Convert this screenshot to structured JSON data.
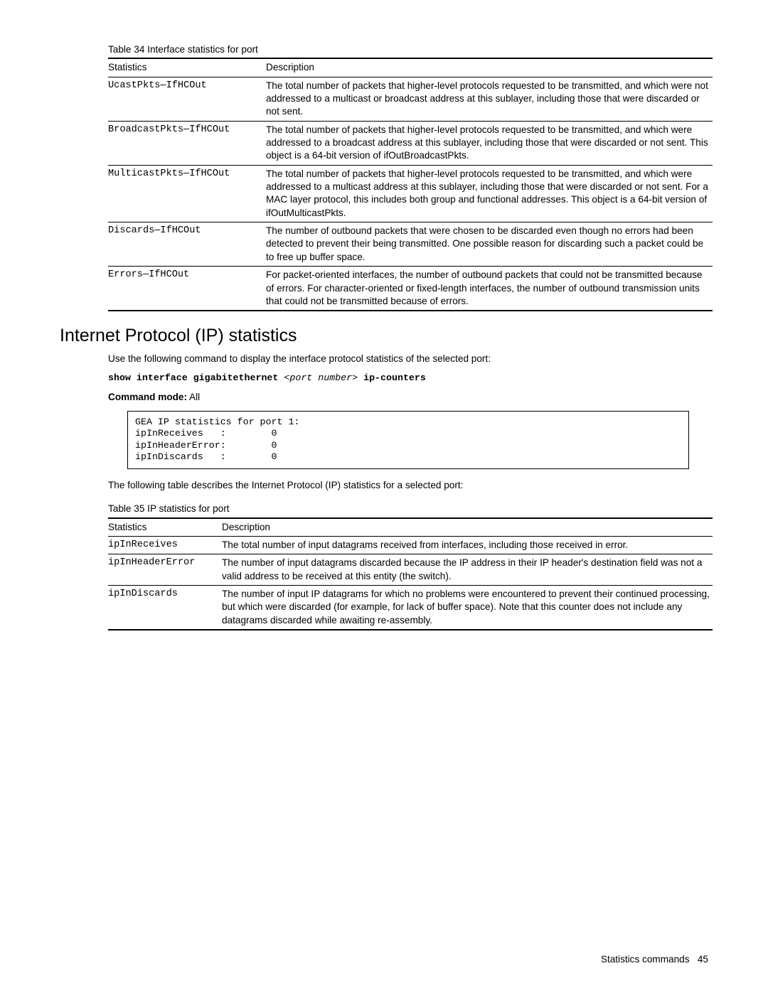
{
  "table34": {
    "caption": "Table 34  Interface statistics for port",
    "head": {
      "c1": "Statistics",
      "c2": "Description"
    },
    "rows": [
      {
        "stat": "UcastPkts—IfHCOut",
        "desc": "The total number of packets that higher-level protocols requested to be transmitted, and which were not addressed to a multicast or broadcast address at this sublayer, including those that were discarded or not sent."
      },
      {
        "stat": "BroadcastPkts—IfHCOut",
        "desc": "The total number of packets that higher-level protocols requested to be transmitted, and which were addressed to a broadcast address at this sublayer, including those that were discarded or not sent. This object is a 64-bit version of ifOutBroadcastPkts."
      },
      {
        "stat": "MulticastPkts—IfHCOut",
        "desc": "The total number of packets that higher-level protocols requested to be transmitted, and which were addressed to a multicast address at this sublayer, including those that were discarded or not sent.\nFor a MAC layer protocol, this includes both group and functional addresses. This object is a 64-bit version of ifOutMulticastPkts."
      },
      {
        "stat": "Discards—IfHCOut",
        "desc": "The number of outbound packets that were chosen to be discarded even though no errors had been detected to prevent their being transmitted. One possible reason for discarding such a packet could be to free up buffer space."
      },
      {
        "stat": "Errors—IfHCOut",
        "desc": "For packet-oriented interfaces, the number of outbound packets that could not be transmitted because of errors.\nFor character-oriented or fixed-length interfaces, the number of outbound transmission units that could not be transmitted because of errors."
      }
    ]
  },
  "section_heading": "Internet Protocol (IP) statistics",
  "intro_p": "Use the following command to display the interface protocol statistics of the selected port:",
  "cmd": {
    "pre": "show interface gigabitethernet ",
    "arg": "<port number>",
    "post": " ip-counters"
  },
  "cmd_mode_label": "Command mode:",
  "cmd_mode_value": " All",
  "output_box": "GEA IP statistics for port 1:\nipInReceives   :        0\nipInHeaderError:        0\nipInDiscards   :        0",
  "after_box_p": "The following table describes the Internet Protocol (IP) statistics for a selected port:",
  "table35": {
    "caption": "Table 35  IP statistics for port",
    "head": {
      "c1": "Statistics",
      "c2": "Description"
    },
    "rows": [
      {
        "stat": "ipInReceives",
        "desc": "The total number of input datagrams received from interfaces, including those received in error."
      },
      {
        "stat": "ipInHeaderError",
        "desc": "The number of input datagrams discarded because the IP address in their IP header's destination field was not a valid address to be received at this entity (the switch)."
      },
      {
        "stat": "ipInDiscards",
        "desc": "The number of input IP datagrams for which no problems were encountered to prevent their continued processing, but which were discarded (for example, for lack of buffer space). Note that this counter does not include any datagrams discarded while awaiting re-assembly."
      }
    ]
  },
  "footer": {
    "label": "Statistics commands",
    "page": "45"
  }
}
